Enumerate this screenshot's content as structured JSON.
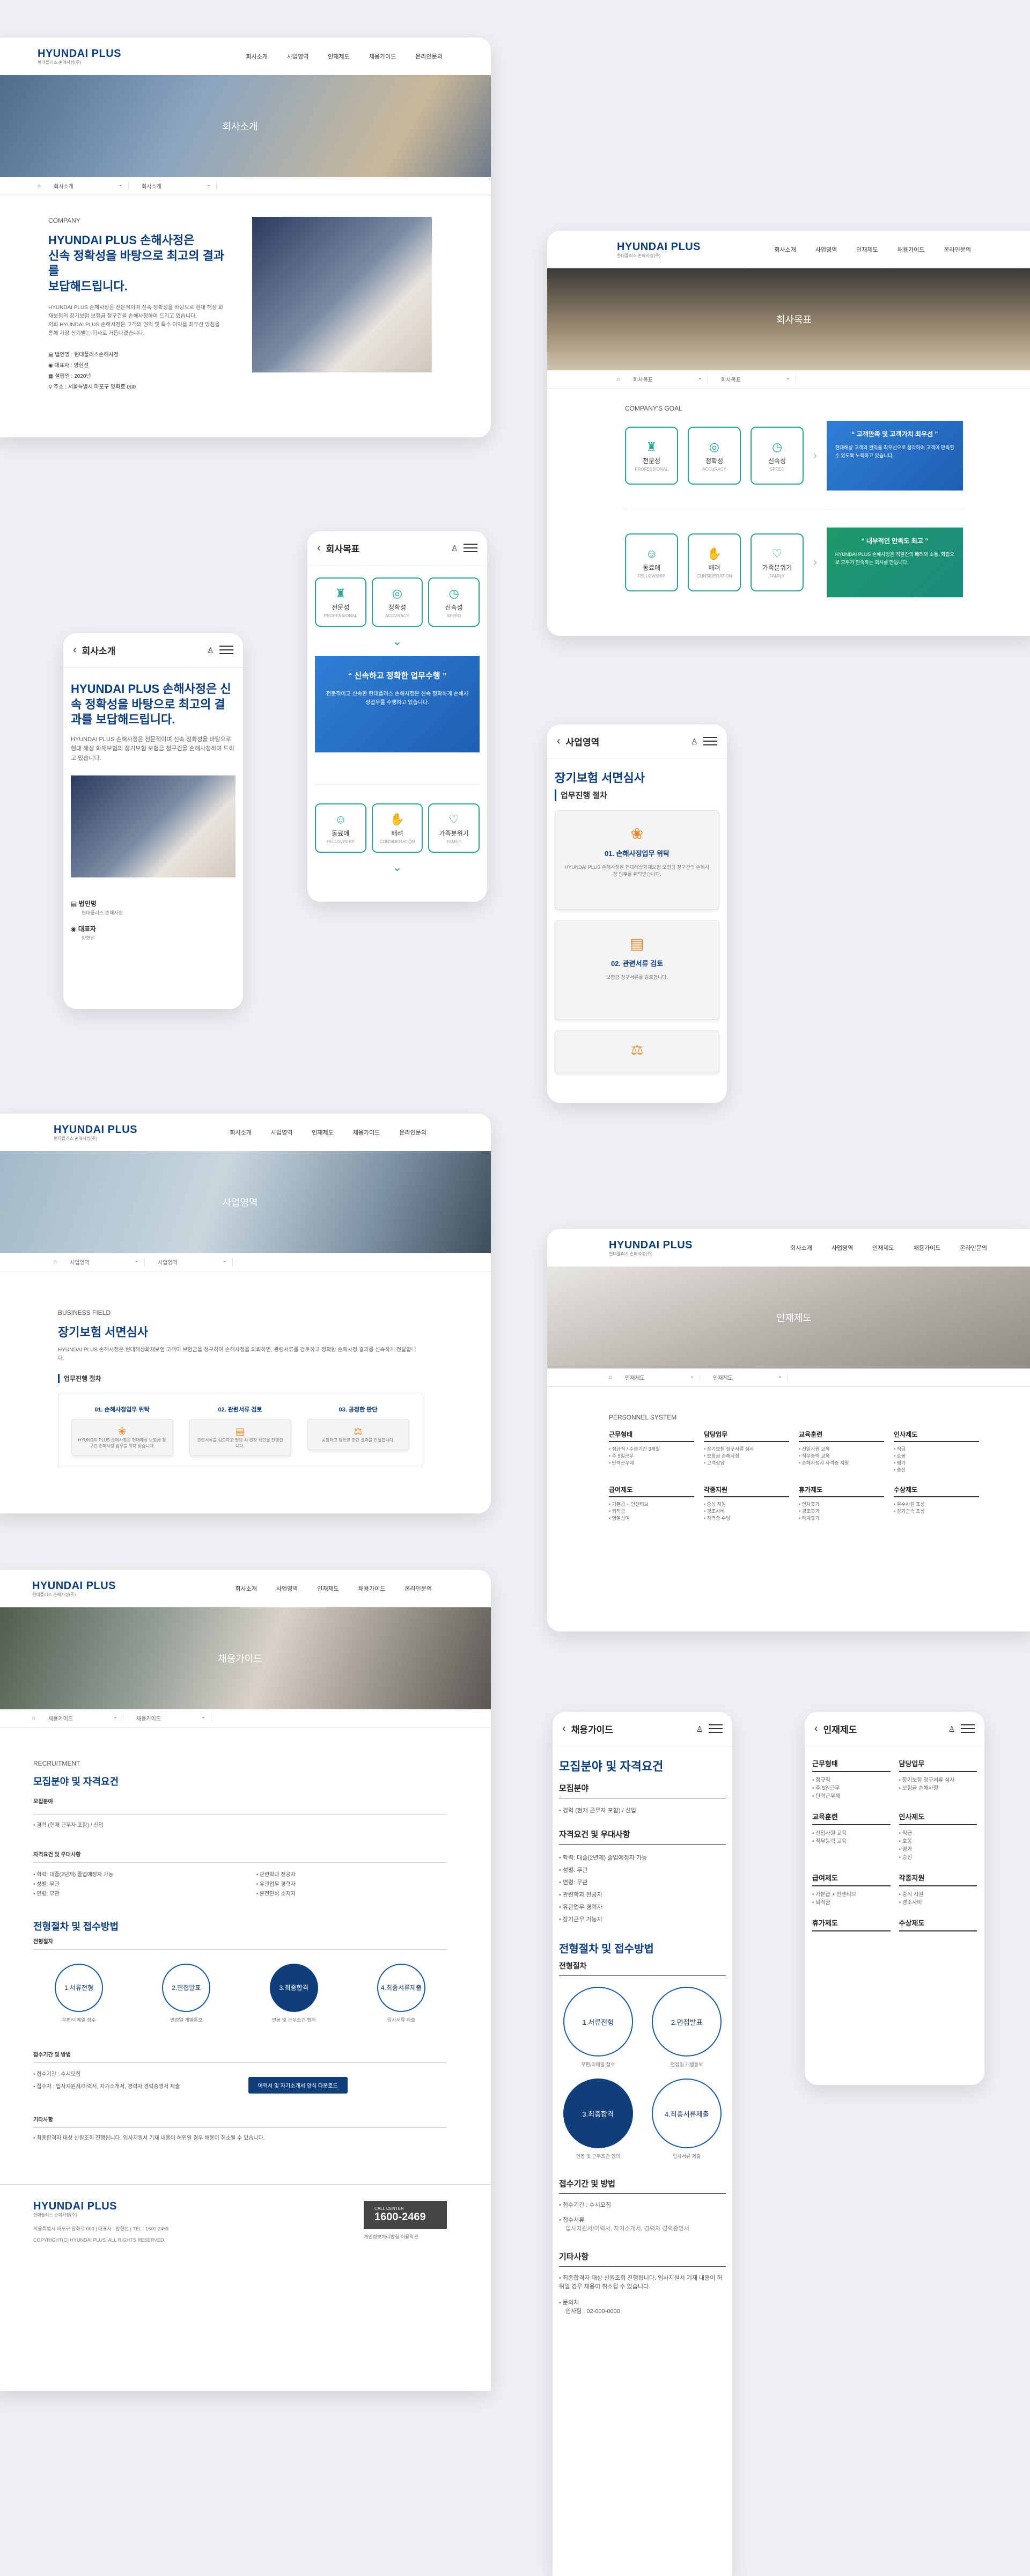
{
  "brand": {
    "name": "HYUNDAI PLUS",
    "sub": "현대플러스 손해사정(주)"
  },
  "nav": [
    "회사소개",
    "사업영역",
    "인재제도",
    "채용가이드",
    "온라인문의"
  ],
  "about": {
    "hero": "회사소개",
    "crumb": "회사소개",
    "eyebrow": "COMPANY",
    "title": "HYUNDAI PLUS 손해사정은\n신속 정확성을 바탕으로 최고의 결과를\n보답해드립니다.",
    "body": "HYUNDAI PLUS 손해사정은 전문적이며 신속 정확성을 바탕으로 현대 해상 화재보험의 장기보험 보험금 청구건을 손해사정하여 드리고 있습니다.\n저희 HYUNDAI PLUS 손해사정은 고객의 권익 및 특수 이익을 최우선 방침을 통해 가장 신뢰받는 회사로 거듭나겠습니다.",
    "info": [
      [
        "법인명",
        "현대플러스손해사정"
      ],
      [
        "대표자",
        "양현선"
      ],
      [
        "설립일",
        "2020년"
      ],
      [
        "주소",
        "서울특별시 마포구 양화로 000"
      ]
    ]
  },
  "goal": {
    "hero": "회사목표",
    "crumb": "회사목표",
    "eyebrow": "COMPANY'S GOAL",
    "tiles1": [
      [
        "전문성",
        "PROFESSIONAL"
      ],
      [
        "정확성",
        "ACCURACY"
      ],
      [
        "신속성",
        "SPEED"
      ]
    ],
    "tiles2": [
      [
        "동료애",
        "FELLOWSHIP"
      ],
      [
        "배려",
        "CONSIDERATION"
      ],
      [
        "가족분위기",
        "FAMILY"
      ]
    ],
    "band1": "“ 고객만족 및 고객가치 최우선 ”",
    "band1txt": "현대해상 고객의 권익을 최우선으로 생각하여 고객이 만족할 수 있도록 노력하고 있습니다.",
    "band2": "“ 내부적인 만족도 최고 ”",
    "band2txt": "HYUNDAI PLUS 손해사정은 직원간의 배려와 소통, 화합으로 모두가 만족하는 회사를 만듭니다.",
    "mband": "“ 신속하고 정확한 업무수행 ”",
    "mbandtxt": "전문적이고 신속한 현대플러스 손해사정은 신속 정확하게 손해사정업무를 수행하고 있습니다."
  },
  "mabout": {
    "title": "회사소개",
    "h": "HYUNDAI PLUS 손해사정은 신속 정확성을 바탕으로 최고의 결과를 보답해드립니다.",
    "body": "HYUNDAI PLUS 손해사정은 전문적이며 신속 정확성을 바탕으로 현대 해상 화재보험의 장기보험 보험금 청구건을 손해사정하여 드리고 있습니다.",
    "info": [
      [
        "법인명",
        "현대플러스 손해사정"
      ],
      [
        "대표자",
        "양현선"
      ]
    ]
  },
  "mbiz": {
    "title": "사업영역",
    "h": "장기보험 서면심사",
    "sub": "업무진행 절차",
    "s1": "01. 손해사정업무 위탁",
    "s1t": "HYUNDAI PLUS 손해사정은 현대해상화재보험 보험금 청구건의 손해사정 업무를 위탁받습니다.",
    "s2": "02. 관련서류 검토",
    "s2t": "보험금 청구서류를 검토합니다."
  },
  "biz": {
    "hero": "사업영역",
    "crumb": "사업영역",
    "eyebrow": "BUSINESS FIELD",
    "title": "장기보험 서면심사",
    "body": "HYUNDAI PLUS 손해사정은 현대해상화재보험 고객이 보험금을 청구하여 손해사정을 의뢰하면, 관련서류를 검토하고 정확한 손해사정 결과를 신속하게 전달합니다.",
    "sub": "업무진행 절차",
    "steps": [
      [
        "01. 손해사정업무 위탁",
        "HYUNDAI PLUS 손해사정은 현대해상 보험금 청구건 손해사정 업무를 위탁 받습니다."
      ],
      [
        "02. 관련서류 검토",
        "관련서류를 검토하고 필요 시 현장 확인을 진행합니다."
      ],
      [
        "03. 공정한 판단",
        "공정하고 정확한 판단 결과를 전달합니다."
      ]
    ]
  },
  "hr": {
    "hero": "인재제도",
    "crumb": "인재제도",
    "eyebrow": "PERSONNEL SYSTEM",
    "cols": [
      [
        "근무형태",
        "정규직 / 수습기간 3개월",
        "주 5일근무",
        "탄력근무제"
      ],
      [
        "담당업무",
        "장기보험 청구서류 심사",
        "보험금 손해사정",
        "고객상담"
      ],
      [
        "교육훈련",
        "신입사원 교육",
        "직무능력 교육",
        "손해사정사 자격증 지원"
      ],
      [
        "인사제도",
        "직급",
        "호봉",
        "평가",
        "승진"
      ],
      [
        "급여제도",
        "기본급 + 인센티브",
        "퇴직금",
        "명절상여"
      ],
      [
        "각종지원",
        "중식 지원",
        "경조사비",
        "자격증 수당"
      ],
      [
        "휴가제도",
        "연차휴가",
        "경조휴가",
        "하계휴가"
      ],
      [
        "수상제도",
        "우수사원 포상",
        "장기근속 포상"
      ]
    ]
  },
  "recruit": {
    "hero": "채용가이드",
    "crumb": "채용가이드",
    "eyebrow": "RECRUITMENT",
    "title": "모집분야 및 자격요건",
    "f1": "모집분야",
    "f1v": "경력 (현재 근무자 포함) / 신입",
    "f2": "자격요건 및 우대사항",
    "req": [
      "학력: 대졸(2년제) 졸업예정자 가능",
      "성별: 무관",
      "연령: 무관"
    ],
    "pref": [
      "관련학과 전공자",
      "유관업무 경력자",
      "운전면허 소지자"
    ],
    "proc": "전형절차 및 접수방법",
    "procsub": "전형절차",
    "steps": [
      "1.서류전형",
      "2.면접발표",
      "3.최종합격",
      "4.최종서류제출"
    ],
    "stepsub": [
      "우편/이메일 접수",
      "면접일 개별통보",
      "연봉 및 근무조건 협의",
      "입사서류 제출"
    ],
    "period": "접수기간 및 방법",
    "periodv": "접수기간 : 수시모집",
    "method": "접수처 : 입사지원서/이력서, 자기소개서, 경력자 경력증명서 제출",
    "btn": "이력서 및 자기소개서 양식 다운로드",
    "etc": "기타사항",
    "etcv": "최종합격자 대상 신원조회 진행됩니다. 입사지원서 기재 내용이 허위일 경우 채용이 취소될 수 있습니다."
  },
  "footer": {
    "addr": "서울특별시 마포구 양화로 000 | 대표자 : 양현선 | TEL : 1600-2469",
    "copy": "COPYRIGHT(C) HYUNDAI PLUS. ALL RIGHTS RESERVED.",
    "callLabel": "CALL CENTER",
    "call": "1600-2469",
    "links": "개인정보처리방침  이용약관"
  },
  "mrecruit": {
    "title": "채용가이드",
    "h": "모집분야 및 자격요건",
    "f1": "모집분야",
    "f1v": "경력 (현재 근무자 포함) / 신입",
    "f2": "자격요건 및 우대사항",
    "items": [
      "학력: 대졸(2년제) 졸업예정자 가능",
      "성별: 무관",
      "연령: 무관",
      "관련학과 전공자",
      "유관업무 경력자",
      "장기근무 가능자"
    ],
    "proc": "전형절차 및 접수방법",
    "procsub": "전형절차",
    "steps": [
      "1.서류전형",
      "2.면접발표",
      "3.최종합격",
      "4.최종서류제출"
    ],
    "stepsub": [
      "우편/이메일 접수",
      "면접일 개별통보",
      "연봉 및 근무조건 협의",
      "입사서류 제출"
    ],
    "period": "접수기간 및 방법",
    "pv1": "접수기간 : 수시모집",
    "pv2": "접수서류",
    "pv3": "입사지원서/이력서, 자기소개서, 경력자 경력증명서",
    "etc": "기타사항",
    "etcv": "최종합격자 대상 신원조회 진행됩니다. 입사지원서 기재 내용이 허위일 경우 채용이 취소될 수 있습니다.",
    "q": "문의처",
    "qv": "인사팀 : 02-000-0000"
  },
  "mhr": {
    "title": "인재제도",
    "cols": [
      [
        "근무형태",
        "정규직",
        "주 5일근무",
        "탄력근무제"
      ],
      [
        "담당업무",
        "장기보험 청구서류 심사",
        "보험금 손해사정"
      ],
      [
        "교육훈련",
        "신입사원 교육",
        "직무능력 교육"
      ],
      [
        "인사제도",
        "직급",
        "호봉",
        "평가",
        "승진"
      ],
      [
        "급여제도",
        "기본급 + 인센티브",
        "퇴직금"
      ],
      [
        "각종지원",
        "중식 지원",
        "경조사비"
      ],
      [
        "휴가제도"
      ],
      [
        "수상제도"
      ]
    ]
  }
}
